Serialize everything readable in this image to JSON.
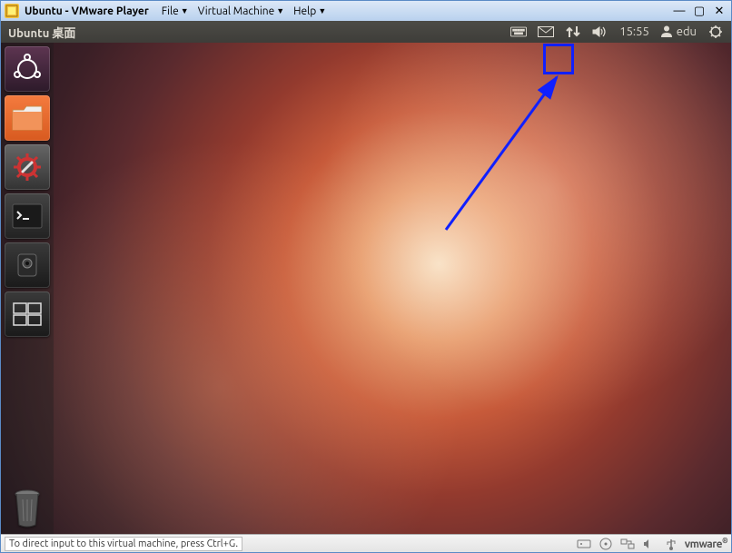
{
  "vmware": {
    "title": "Ubuntu - VMware Player",
    "menus": [
      "File",
      "Virtual Machine",
      "Help"
    ],
    "status_text": "To direct input to this virtual machine, press Ctrl+G.",
    "brand": "vmware"
  },
  "ubuntu": {
    "panel_title": "Ubuntu 桌面",
    "time": "15:55",
    "user": "edu",
    "indicators": {
      "keyboard": "keyboard-icon",
      "messages": "mail-icon",
      "network": "network-updown-icon",
      "sound": "volume-icon",
      "session": "power-cog-icon",
      "user_icon": "user-icon"
    }
  },
  "launcher": {
    "items": [
      {
        "name": "dash-home",
        "label": "Dash Home"
      },
      {
        "name": "files",
        "label": "Files"
      },
      {
        "name": "system-settings",
        "label": "System Settings"
      },
      {
        "name": "terminal",
        "label": "Terminal"
      },
      {
        "name": "devices",
        "label": "Devices"
      },
      {
        "name": "workspace-switcher",
        "label": "Workspace Switcher"
      }
    ],
    "trash": {
      "name": "trash",
      "label": "Trash"
    }
  },
  "annotation": {
    "target": "network-indicator",
    "color": "#1020ff"
  }
}
